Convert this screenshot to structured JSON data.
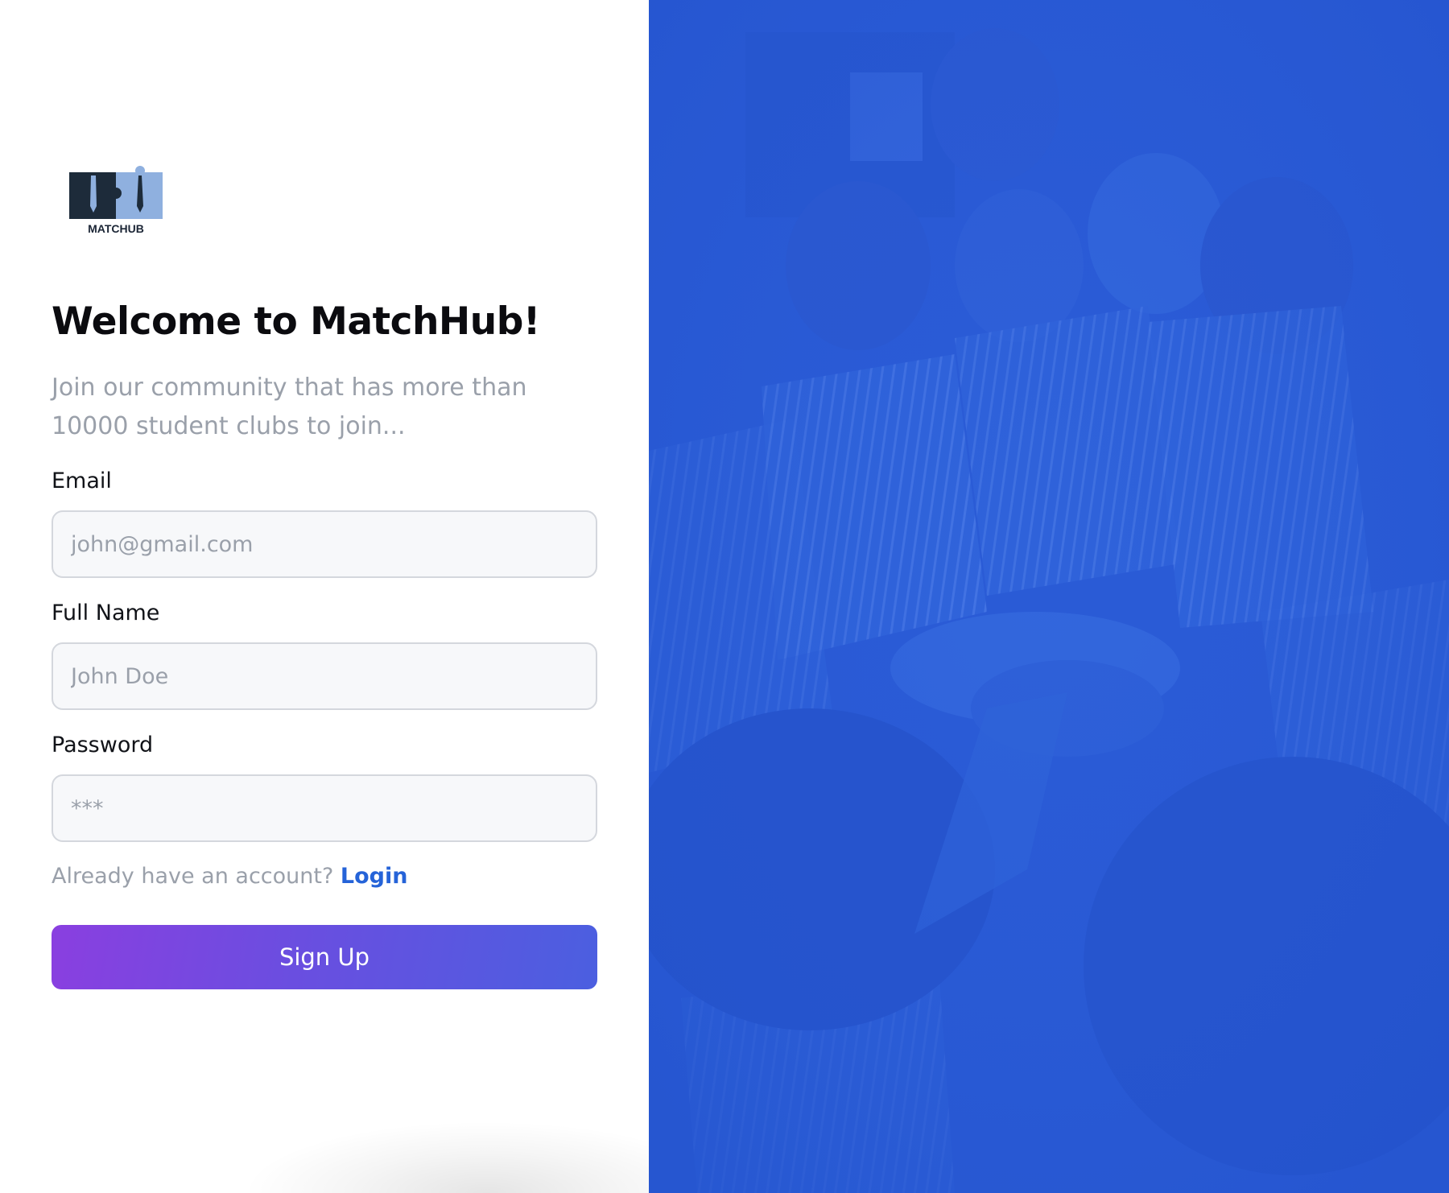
{
  "brand": {
    "logo_text": "MATCHUB",
    "logo_icon": "matchhub-logo-icon"
  },
  "header": {
    "title": "Welcome to MatchHub!",
    "subtitle": "Join our community that has more than 10000 student clubs to join..."
  },
  "form": {
    "email": {
      "label": "Email",
      "placeholder": "john@gmail.com",
      "value": ""
    },
    "full_name": {
      "label": "Full Name",
      "placeholder": "John Doe",
      "value": ""
    },
    "password": {
      "label": "Password",
      "placeholder": "***",
      "value": ""
    },
    "account_prompt": "Already have an account?",
    "login_link": "Login",
    "submit_label": "Sign Up"
  },
  "hero": {
    "image": "students-group-photo-blue-overlay"
  },
  "colors": {
    "accent_link": "#2563d8",
    "hero_overlay": "#2a5bd6",
    "button_gradient_start": "#8a3fe0",
    "button_gradient_end": "#4b5fe0",
    "title_text": "#0b0b0f",
    "muted_text": "#9aa0aa"
  }
}
